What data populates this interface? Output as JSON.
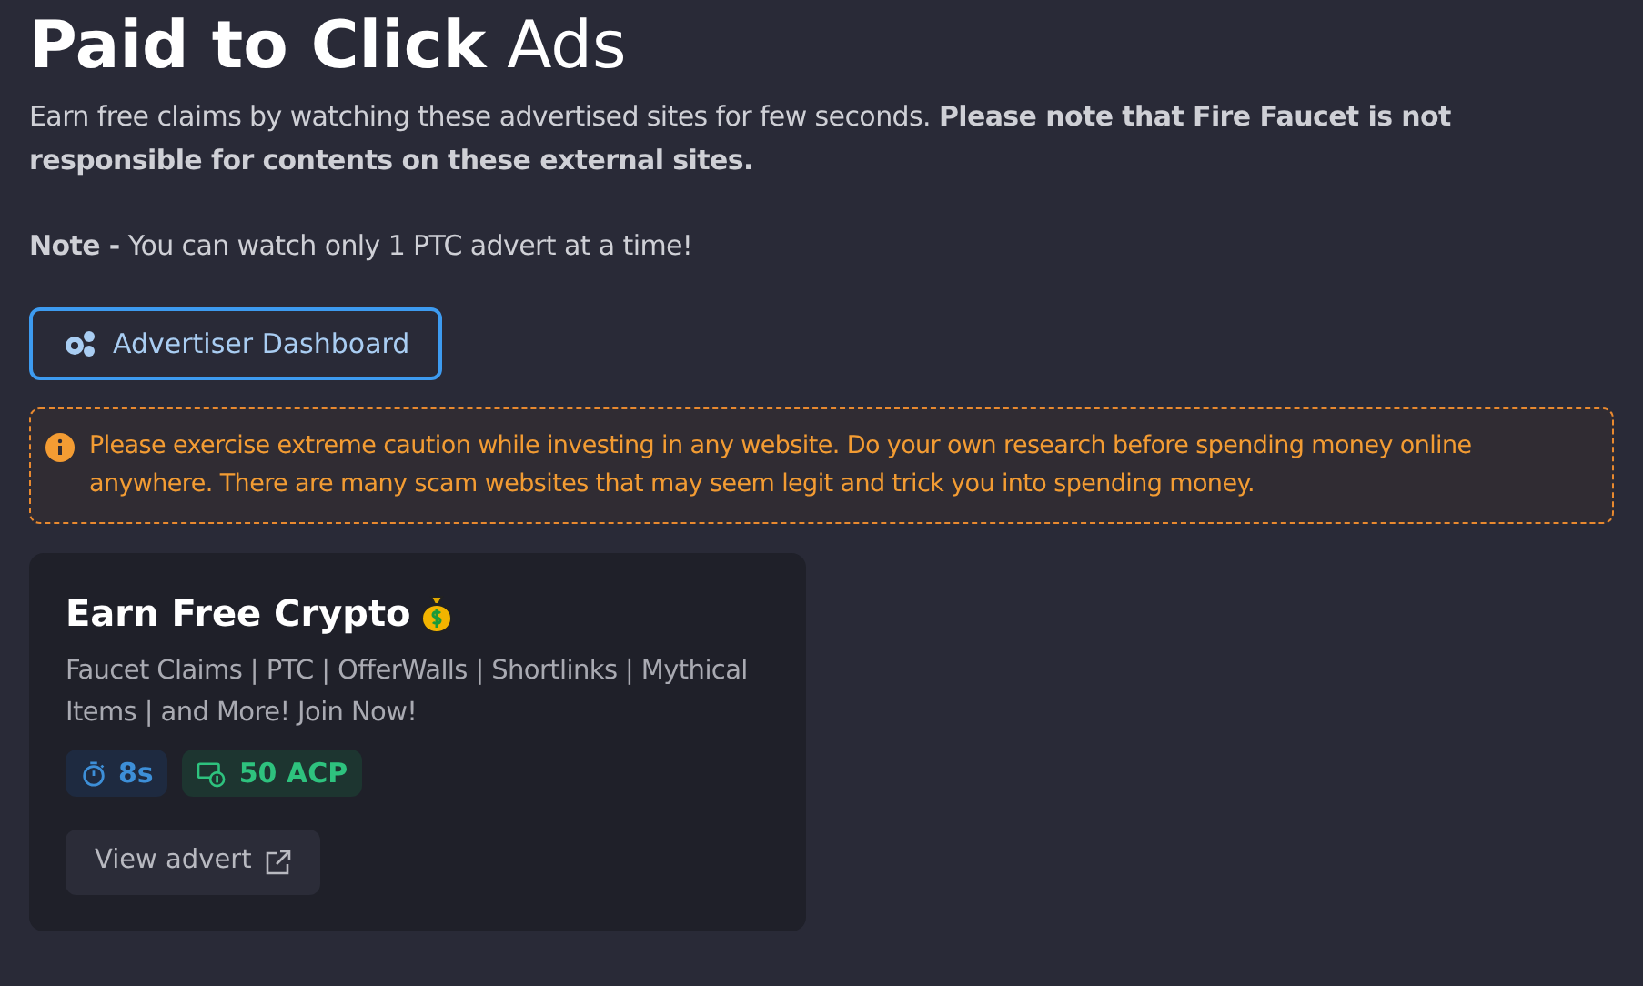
{
  "heading": "**Paid to Click** Ads",
  "intro": "Earn free claims by watching these advertised sites for few seconds. **Please note that Fire Faucet is not responsible for contents on these external sites.**",
  "note": "**Note -** You can watch only 1 PTC advert at a time!",
  "dashboard_button": "Advertiser Dashboard",
  "warning": "Please exercise extreme caution while investing in any website. Do your own research before spending money online anywhere. There are many scam websites that may seem legit and trick you into spending money.",
  "ads": [
    {
      "title": "Earn Free Crypto",
      "description": "Faucet Claims | PTC | OfferWalls | Shortlinks | Mythical Items | and More! Join Now!",
      "badges": [
        {
          "kind": "timer",
          "text": "8s"
        },
        {
          "kind": "reward",
          "text": "50 ACP"
        }
      ],
      "button": "View advert"
    }
  ]
}
